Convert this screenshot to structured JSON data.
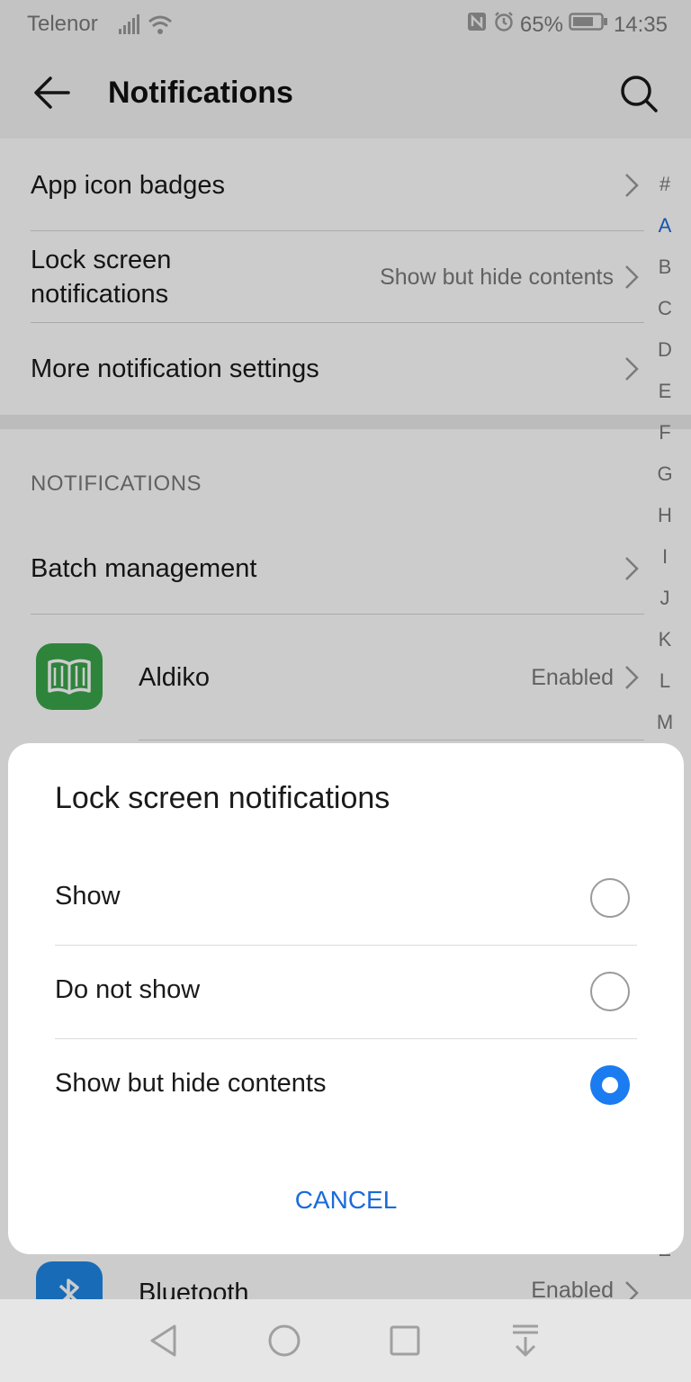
{
  "status_bar": {
    "carrier": "Telenor",
    "battery": "65%",
    "time": "14:35"
  },
  "header": {
    "title": "Notifications"
  },
  "settings": {
    "app_icon_badges": "App icon badges",
    "lock_screen_line1": "Lock screen",
    "lock_screen_line2": "notifications",
    "lock_screen_value": "Show but hide contents",
    "more_settings": "More notification settings"
  },
  "notifications_section": {
    "header": "NOTIFICATIONS",
    "batch_management": "Batch management",
    "apps": [
      {
        "name": "Aldiko",
        "status": "Enabled",
        "icon": "book-icon",
        "color": "#3aa64a"
      },
      {
        "name": "Bluetooth",
        "status": "Enabled",
        "icon": "bluetooth-icon",
        "color": "#1e88e5"
      }
    ]
  },
  "index_letters": [
    "#",
    "A",
    "B",
    "C",
    "D",
    "E",
    "F",
    "G",
    "H",
    "I",
    "J",
    "K",
    "L",
    "M",
    "Z"
  ],
  "index_active": "A",
  "dialog": {
    "title": "Lock screen notifications",
    "options": [
      {
        "label": "Show",
        "selected": false
      },
      {
        "label": "Do not show",
        "selected": false
      },
      {
        "label": "Show but hide contents",
        "selected": true
      }
    ],
    "cancel_label": "CANCEL"
  },
  "colors": {
    "accent": "#1a7cf0",
    "link": "#1a6cd8"
  }
}
